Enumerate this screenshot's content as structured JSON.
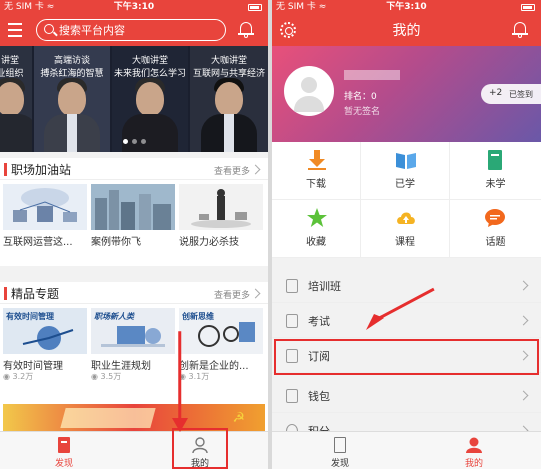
{
  "status": {
    "carrier": "无 SIM 卡 ≈",
    "time": "下午3:10"
  },
  "left": {
    "search": {
      "placeholder": "搜索平台内容"
    },
    "banner": [
      {
        "line1": "讲堂",
        "line2": "业组织"
      },
      {
        "line1": "高端访谈",
        "line2": "搏杀红海的智慧"
      },
      {
        "line1": "大咖讲堂",
        "line2": "未来我们怎么学习"
      },
      {
        "line1": "大咖讲堂",
        "line2": "互联网与共享经济"
      }
    ],
    "section1": {
      "title": "职场加油站",
      "more": "查看更多",
      "cards": [
        {
          "title": "互联网运营这..."
        },
        {
          "title": "案例带你飞"
        },
        {
          "title": "说服力必杀技"
        }
      ]
    },
    "section2": {
      "title": "精品专题",
      "more": "查看更多",
      "cards": [
        {
          "title": "有效时间管理",
          "views": "3.2万",
          "badge": "有效时间管理"
        },
        {
          "title": "职业生涯规划",
          "views": "3.5万",
          "badge": "职场新人类"
        },
        {
          "title": "创新是企业的...",
          "views": "3.1万",
          "badge": "创新思维"
        }
      ]
    },
    "tabs": {
      "discover": "发现",
      "mine": "我的"
    }
  },
  "right": {
    "title": "我的",
    "profile": {
      "rank": "排名：0",
      "motto": "暂无签名",
      "signin_plus": "+2",
      "signin_text": "已签到"
    },
    "grid": [
      {
        "label": "下载",
        "icon": "download-icon"
      },
      {
        "label": "已学",
        "icon": "book-icon"
      },
      {
        "label": "未学",
        "icon": "unread-book-icon"
      },
      {
        "label": "收藏",
        "icon": "star-icon"
      },
      {
        "label": "课程",
        "icon": "cloud-upload-icon"
      },
      {
        "label": "话题",
        "icon": "chat-bubble-icon"
      }
    ],
    "menu": [
      {
        "label": "培训班"
      },
      {
        "label": "考试"
      },
      {
        "label": "订阅"
      },
      {
        "label": "钱包"
      },
      {
        "label": "积分"
      }
    ],
    "tabs": {
      "discover": "发现",
      "mine": "我的"
    }
  },
  "colors": {
    "brand_red": "#e8443c",
    "highlight_red": "#e62e2e"
  }
}
